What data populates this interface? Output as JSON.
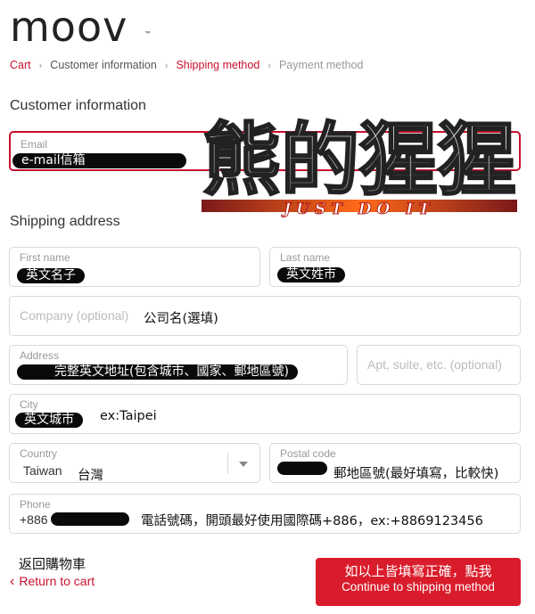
{
  "brand": {
    "logo_text": "moov",
    "trademark": "™"
  },
  "breadcrumb": {
    "items": [
      "Cart",
      "Customer information",
      "Shipping method",
      "Payment method"
    ],
    "separator": "›",
    "active_color": "#c8102e"
  },
  "customer": {
    "title": "Customer information",
    "email_label": "Email",
    "email_value": "e-mail信箱"
  },
  "shipping": {
    "title": "Shipping address",
    "first_name_label": "First name",
    "first_name_value": "英文名子",
    "last_name_label": "Last name",
    "last_name_value": "英文姓市",
    "company_placeholder": "Company (optional)",
    "company_note": "公司名(選填)",
    "address_label": "Address",
    "address_value": "完整英文地址(包含城市、國家、郵地區號)",
    "apt_placeholder": "Apt, suite, etc. (optional)",
    "city_label": "City",
    "city_value": "英文城市",
    "city_note": "ex:Taipei",
    "country_label": "Country",
    "country_value": "Taiwan",
    "country_note": "台灣",
    "postal_label": "Postal code",
    "postal_note": "郵地區號(最好填寫，比較快)",
    "phone_label": "Phone",
    "phone_prefix": "+886",
    "phone_note": "電話號碼，開頭最好使用國際碼+886，ex:+8869123456"
  },
  "footer": {
    "back_note": "返回購物車",
    "return_link": "Return to cart",
    "button_note": "如以上皆填寫正確，點我",
    "button_label": "Continue to shipping method"
  },
  "watermark": {
    "text": "熊的猩猩",
    "subtext": "JUST DO IT"
  },
  "colors": {
    "accent": "#c8102e",
    "button": "#d91c2b",
    "border": "#d9d9d9"
  }
}
